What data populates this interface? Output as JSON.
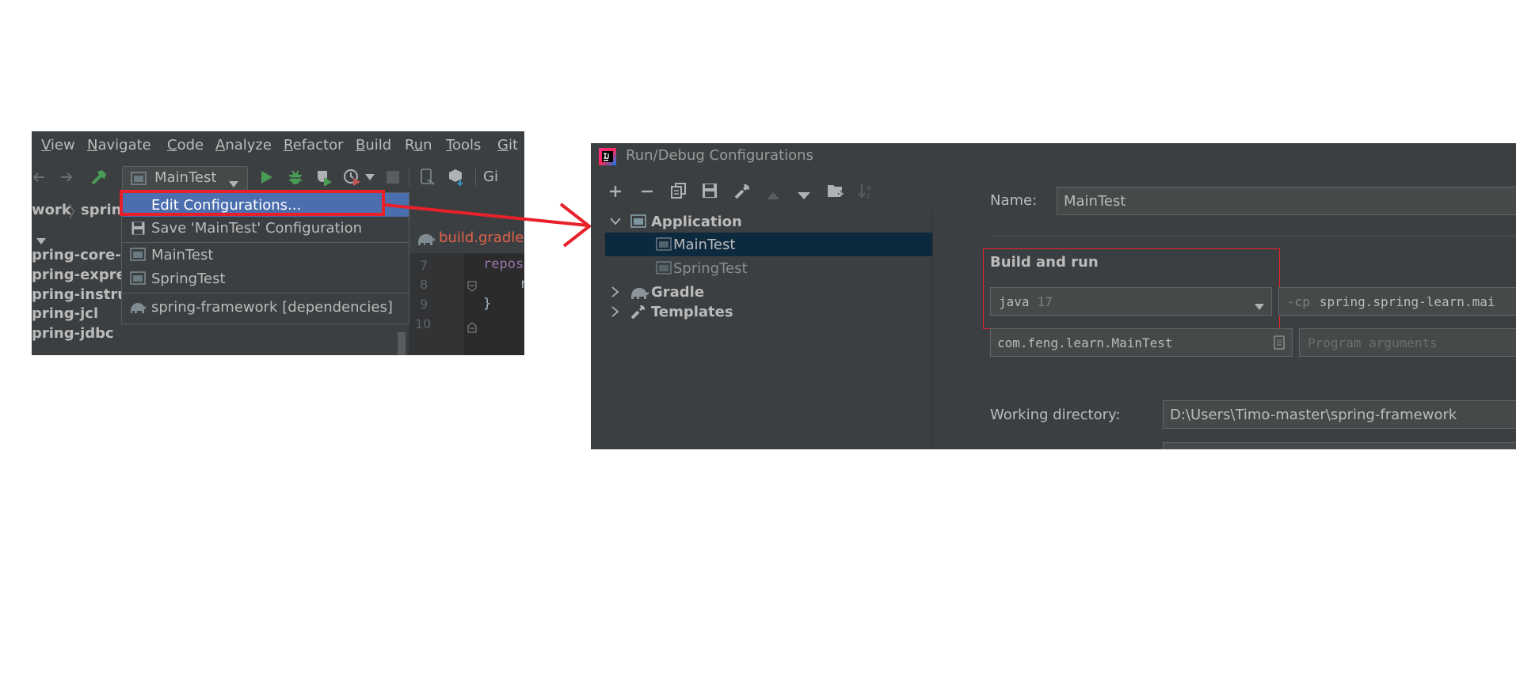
{
  "ide": {
    "menu": [
      "View",
      "Navigate",
      "Code",
      "Analyze",
      "Refactor",
      "Build",
      "Run",
      "Tools",
      "Git"
    ],
    "menu_mnemonics": [
      "V",
      "N",
      "C",
      "A",
      "R",
      "B",
      "u",
      "T",
      "G"
    ],
    "run_config": "MainTest",
    "toolbar_trailing": "Gi",
    "breadcrumb": [
      "work",
      "sprin"
    ],
    "project_tree": [
      "pring-core-te",
      "pring-express",
      "pring-instrum",
      "pring-jcl",
      "pring-jdbc"
    ],
    "editor_tab": "build.gradle",
    "line_numbers": [
      "7",
      "8",
      "9",
      "10"
    ],
    "code": [
      "repos",
      "r",
      "}"
    ],
    "popup": {
      "edit_configurations": "Edit Configurations...",
      "save_configuration": "Save 'MainTest' Configuration",
      "configs": [
        "MainTest",
        "SpringTest"
      ],
      "dependencies": "spring-framework [dependencies]"
    }
  },
  "dialog": {
    "title": "Run/Debug Configurations",
    "tree": {
      "application": "Application",
      "children": [
        "MainTest",
        "SpringTest"
      ],
      "gradle": "Gradle",
      "templates": "Templates"
    },
    "name_label": "Name:",
    "name_value": "MainTest",
    "section": "Build and run",
    "jre": {
      "name": "java",
      "version": "17"
    },
    "cp_flag": "-cp",
    "cp_value": "spring.spring-learn.mai",
    "main_class": "com.feng.learn.MainTest",
    "program_args_placeholder": "Program arguments",
    "working_dir_label": "Working directory:",
    "working_dir_value": "D:\\Users\\Timo-master\\spring-framework"
  },
  "colors": {
    "ide_bg": "#3c3f41",
    "highlight": "#4b6eaf",
    "selection": "#0d293e",
    "annotation_red": "#e8202a",
    "text": "#bbbbbb",
    "run_green": "#499c54"
  }
}
